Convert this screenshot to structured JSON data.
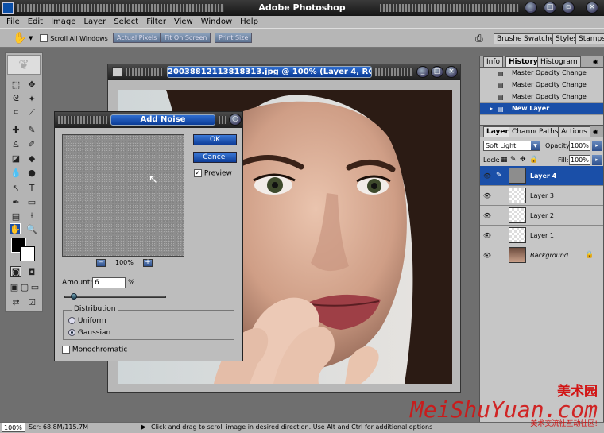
{
  "app": {
    "title": "Adobe Photoshop"
  },
  "menu": [
    "File",
    "Edit",
    "Image",
    "Layer",
    "Select",
    "Filter",
    "View",
    "Window",
    "Help"
  ],
  "options_bar": {
    "scroll_all_label": "Scroll All Windows",
    "buttons": [
      "Actual Pixels",
      "Fit On Screen",
      "Print Size"
    ],
    "palette_tabs": [
      "Brushes",
      "Swatches",
      "Styles",
      "Stamps"
    ]
  },
  "document": {
    "title": "20038812113818313.jpg @ 100% (Layer 4, RGB/8#)"
  },
  "add_noise": {
    "title": "Add Noise",
    "ok": "OK",
    "cancel": "Cancel",
    "preview_label": "Preview",
    "zoom": "100%",
    "amount_label": "Amount:",
    "amount_value": "6",
    "amount_unit": "%",
    "amount_fraction": 0.06,
    "distribution_label": "Distribution",
    "uniform": "Uniform",
    "gaussian": "Gaussian",
    "monochromatic": "Monochromatic"
  },
  "history_palette": {
    "tabs": [
      "Info",
      "History",
      "Histogram"
    ],
    "items": [
      "Master Opacity Change",
      "Master Opacity Change",
      "Master Opacity Change",
      "New Layer"
    ]
  },
  "layers_palette": {
    "tabs": [
      "Layers",
      "Channels",
      "Paths",
      "Actions"
    ],
    "blend_mode": "Soft Light",
    "opacity_label": "Opacity:",
    "opacity": "100%",
    "lock_label": "Lock:",
    "fill_label": "Fill:",
    "fill": "100%",
    "layers": [
      "Layer 4",
      "Layer 3",
      "Layer 2",
      "Layer 1",
      "Background"
    ]
  },
  "status": {
    "zoom": "100%",
    "scratch": "Scr: 68.8M/115.7M",
    "hint": "Click and drag to scroll image in desired direction.  Use Alt and Ctrl for additional options"
  },
  "watermark": {
    "cn_name": "美术园",
    "site": "MeiShuYuan.com",
    "slogan": "美术交流社互动社区!"
  },
  "colors": {
    "selected_blue": "#1a4fa8",
    "watermark_red": "#d21414"
  }
}
